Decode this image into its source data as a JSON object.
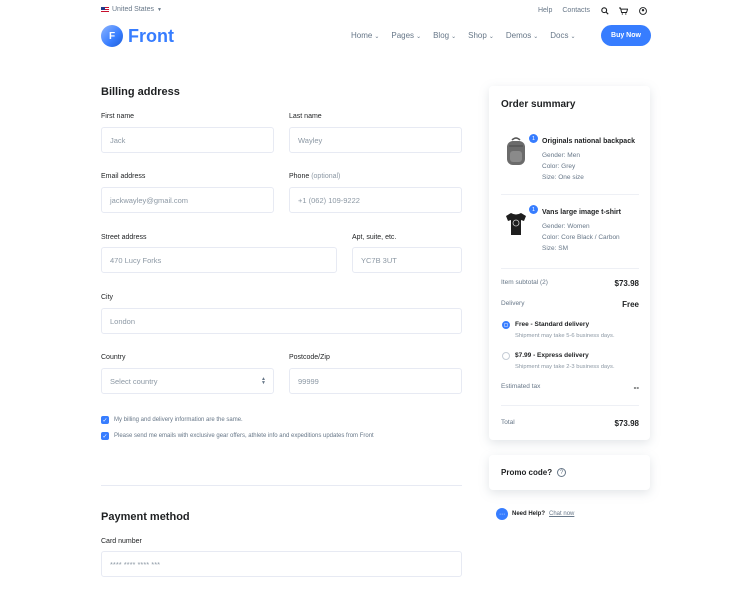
{
  "topbar": {
    "language": "United States",
    "links": [
      "Help",
      "Contacts"
    ]
  },
  "header": {
    "logo_letter": "F",
    "logo_text": "Front",
    "nav": [
      "Home",
      "Pages",
      "Blog",
      "Shop",
      "Demos",
      "Docs"
    ],
    "buy_now": "Buy Now"
  },
  "billing": {
    "title": "Billing address",
    "first_name": {
      "label": "First name",
      "placeholder": "Jack"
    },
    "last_name": {
      "label": "Last name",
      "placeholder": "Wayley"
    },
    "email": {
      "label": "Email address",
      "placeholder": "jackwayley@gmail.com"
    },
    "phone": {
      "label": "Phone",
      "optional": "(optional)",
      "placeholder": "+1 (062) 109-9222"
    },
    "street": {
      "label": "Street address",
      "placeholder": "470 Lucy Forks"
    },
    "apt": {
      "label": "Apt, suite, etc.",
      "placeholder": "YC7B 3UT"
    },
    "city": {
      "label": "City",
      "placeholder": "London"
    },
    "country": {
      "label": "Country",
      "placeholder": "Select country"
    },
    "postcode": {
      "label": "Postcode/Zip",
      "placeholder": "99999"
    },
    "check_same": "My billing and delivery information are the same.",
    "check_emails": "Please send me emails with exclusive gear offers, athlete info and expeditions updates from Front"
  },
  "payment": {
    "title": "Payment method",
    "card_label": "Card number",
    "card_placeholder": "**** **** **** ***"
  },
  "summary": {
    "title": "Order summary",
    "items": [
      {
        "qty": "1",
        "name": "Originals national backpack",
        "attrs": [
          "Gender: Men",
          "Color: Grey",
          "Size: One size"
        ]
      },
      {
        "qty": "1",
        "name": "Vans large image t-shirt",
        "attrs": [
          "Gender: Women",
          "Color: Core Black / Carbon",
          "Size: SM"
        ]
      }
    ],
    "subtotal_label": "Item subtotal (2)",
    "subtotal_value": "$73.98",
    "delivery_label": "Delivery",
    "delivery_value": "Free",
    "options": [
      {
        "title": "Free - Standard delivery",
        "sub": "Shipment may take 5-6 business days.",
        "selected": true
      },
      {
        "title": "$7.99 - Express delivery",
        "sub": "Shipment may take 2-3 business days.",
        "selected": false
      }
    ],
    "tax_label": "Estimated tax",
    "tax_value": "--",
    "total_label": "Total",
    "total_value": "$73.98"
  },
  "promo": {
    "label": "Promo code?"
  },
  "help": {
    "label": "Need Help?",
    "chat": "Chat now"
  }
}
